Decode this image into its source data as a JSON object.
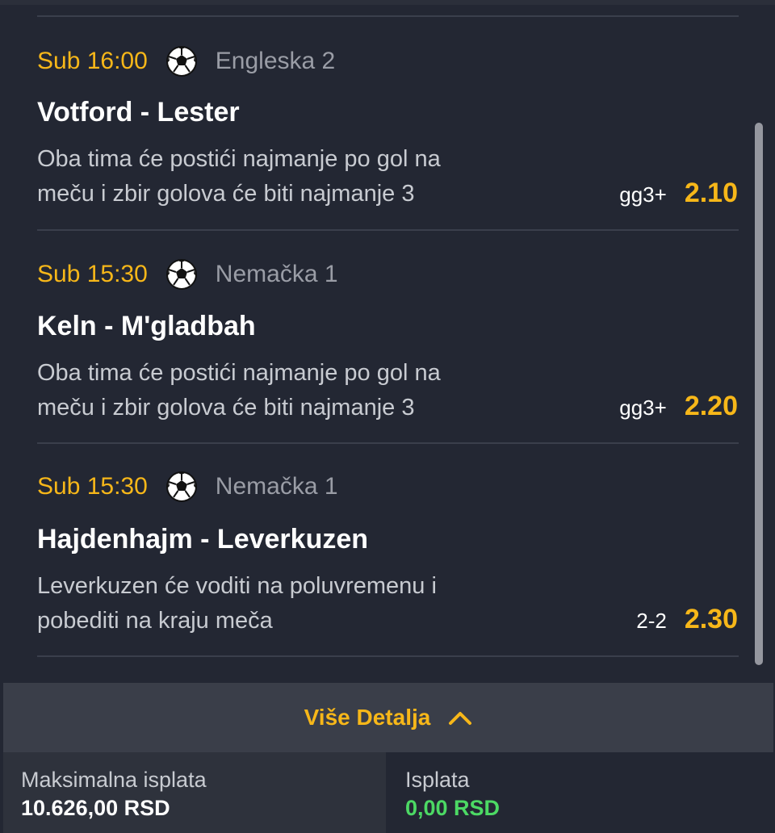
{
  "tickets": [
    {
      "time": "Sub 16:00",
      "sport_icon": "soccer-ball-icon",
      "league": "Engleska 2",
      "teams": "Votford - Lester",
      "desc_line1": "Oba tima će postići najmanje po gol na",
      "desc_line2": "meču i zbir golova će biti najmanje 3",
      "bet_code": "gg3+",
      "odds": "2.10"
    },
    {
      "time": "Sub 15:30",
      "sport_icon": "soccer-ball-icon",
      "league": "Nemačka 1",
      "teams": "Keln - M'gladbah",
      "desc_line1": "Oba tima će postići najmanje po gol na",
      "desc_line2": "meču i zbir golova će biti najmanje 3",
      "bet_code": "gg3+",
      "odds": "2.20"
    },
    {
      "time": "Sub 15:30",
      "sport_icon": "soccer-ball-icon",
      "league": "Nemačka 1",
      "teams": "Hajdenhajm - Leverkuzen",
      "desc_line1": "Leverkuzen će voditi na poluvremenu i",
      "desc_line2": "pobediti na kraju meča",
      "bet_code": "2-2",
      "odds": "2.30"
    }
  ],
  "more_details": {
    "label": "Više Detalja",
    "icon": "chevron-up-icon"
  },
  "footer": {
    "max_payout_label": "Maksimalna isplata",
    "max_payout_value": "10.626,00 RSD",
    "payout_label": "Isplata",
    "payout_value": "0,00 RSD"
  },
  "colors": {
    "accent": "#f7b719",
    "positive": "#4cd964",
    "background": "#232733"
  }
}
